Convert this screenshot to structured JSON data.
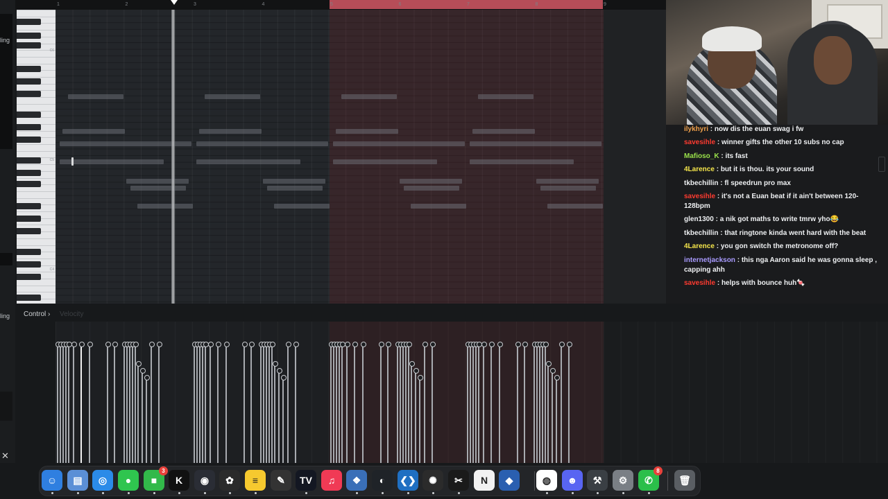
{
  "left_panel": {
    "label_top": "ling",
    "label_bottom": "ling",
    "close_label": "✕"
  },
  "ruler": {
    "bar_numbers": [
      "1",
      "2",
      "3",
      "4",
      "5",
      "6",
      "7",
      "8",
      "9"
    ]
  },
  "piano": {
    "octave_labels": [
      "C6",
      "C5",
      "C4"
    ]
  },
  "control": {
    "label": "Control",
    "arrow": "›",
    "mode": "Velocity"
  },
  "chat": {
    "messages": [
      {
        "user": "ilykhyri",
        "color": "#f0a04b",
        "text": "now dis the euan swag i fw"
      },
      {
        "user": "savesihle",
        "color": "#ff3b30",
        "text": "winner gifts the other 10 subs no cap"
      },
      {
        "user": "Mafioso_K",
        "color": "#9ae24a",
        "text": "its fast"
      },
      {
        "user": "4Larence",
        "color": "#f5e64b",
        "text": "but it is thou. its your sound"
      },
      {
        "user": "tkbechillin",
        "color": "#eef0f2",
        "text": "fl speedrun pro max"
      },
      {
        "user": "savesihle",
        "color": "#ff3b30",
        "text": "it's not a Euan beat if it ain't between 120-128bpm"
      },
      {
        "user": "glen1300",
        "color": "#eef0f2",
        "text": "a nik got maths to write tmrw yho😂"
      },
      {
        "user": "tkbechillin",
        "color": "#eef0f2",
        "text": "that ringtone kinda went hard with the beat"
      },
      {
        "user": "4Larence",
        "color": "#f5e64b",
        "text": "you gon switch the metronome off?"
      },
      {
        "user": "internetjackson",
        "color": "#a99bff",
        "text": "this nga Aaron said he was gonna sleep , capping ahh"
      },
      {
        "user": "savesihle",
        "color": "#ff3b30",
        "text": "helps with bounce huh🍬"
      }
    ]
  },
  "dock": {
    "items": [
      {
        "name": "finder-icon",
        "glyph": "☺",
        "bg": "#2f7fe0"
      },
      {
        "name": "files-icon",
        "glyph": "▤",
        "bg": "#5b8fd6"
      },
      {
        "name": "safari-icon",
        "glyph": "◎",
        "bg": "#2b8be8"
      },
      {
        "name": "messages-icon",
        "glyph": "●",
        "bg": "#2fc54f"
      },
      {
        "name": "facetime-icon",
        "glyph": "■",
        "bg": "#32b94a",
        "badge": "3"
      },
      {
        "name": "kick-icon",
        "glyph": "K",
        "bg": "#111111"
      },
      {
        "name": "obs-icon",
        "glyph": "◉",
        "bg": "#2a2d35"
      },
      {
        "name": "fl-studio-icon",
        "glyph": "✿",
        "bg": "#2b2b2b"
      },
      {
        "name": "notes-icon",
        "glyph": "≡",
        "bg": "#f6c92f"
      },
      {
        "name": "pen-icon",
        "glyph": "✎",
        "bg": "#333333"
      },
      {
        "name": "tradingview-icon",
        "glyph": "TV",
        "bg": "#131722"
      },
      {
        "name": "music-icon",
        "glyph": "♫",
        "bg": "#f03a55"
      },
      {
        "name": "davinci-icon",
        "glyph": "❖",
        "bg": "#3a6fb8"
      },
      {
        "name": "github-icon",
        "glyph": "◐",
        "bg": "#1f2328"
      },
      {
        "name": "vscode-icon",
        "glyph": "❮❯",
        "bg": "#1f6fc2"
      },
      {
        "name": "chatgpt-icon",
        "glyph": "✺",
        "bg": "#2b2b2b"
      },
      {
        "name": "capcut-icon",
        "glyph": "✂",
        "bg": "#1a1a1a"
      },
      {
        "name": "notion-icon",
        "glyph": "N",
        "bg": "#f2f2f2"
      },
      {
        "name": "virtualbox-icon",
        "glyph": "◆",
        "bg": "#2a5fb0"
      },
      {
        "name": "chrome-icon",
        "glyph": "◍",
        "bg": "#ffffff"
      },
      {
        "name": "discord-icon",
        "glyph": "☻",
        "bg": "#5865f2"
      },
      {
        "name": "tools-icon",
        "glyph": "⚒",
        "bg": "#3a3f44"
      },
      {
        "name": "system-settings-icon",
        "glyph": "⚙",
        "bg": "#7a7f85"
      },
      {
        "name": "whatsapp-icon",
        "glyph": "✆",
        "bg": "#2bbf4a",
        "badge": "8"
      },
      {
        "name": "trash-icon",
        "glyph": "🗑",
        "bg": "#5a5e63"
      }
    ]
  }
}
